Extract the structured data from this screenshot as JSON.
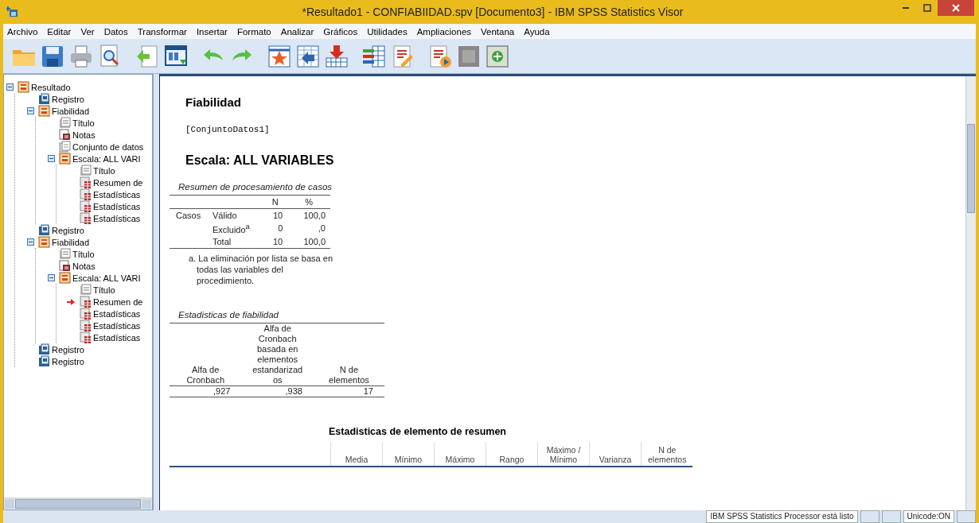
{
  "window": {
    "title": "*Resultado1 - CONFIABIIDAD.spv [Documento3] - IBM SPSS Statistics Visor"
  },
  "menu": [
    {
      "label": "Archivo"
    },
    {
      "label": "Editar"
    },
    {
      "label": "Ver"
    },
    {
      "label": "Datos"
    },
    {
      "label": "Transformar"
    },
    {
      "label": "Insertar"
    },
    {
      "label": "Formato"
    },
    {
      "label": "Analizar"
    },
    {
      "label": "Gráficos"
    },
    {
      "label": "Utilidades"
    },
    {
      "label": "Ampliaciones"
    },
    {
      "label": "Ventana"
    },
    {
      "label": "Ayuda"
    }
  ],
  "outline": {
    "items": [
      {
        "kind": "folder",
        "label": "Resultado",
        "expanded": true,
        "current": false,
        "children": [
          {
            "kind": "log",
            "label": "Registro",
            "current": false
          },
          {
            "kind": "folder",
            "label": "Fiabilidad",
            "expanded": true,
            "current": false,
            "children": [
              {
                "kind": "title",
                "label": "Título",
                "current": false
              },
              {
                "kind": "notes",
                "label": "Notas",
                "current": false
              },
              {
                "kind": "text",
                "label": "Conjunto de datos",
                "current": false
              },
              {
                "kind": "folder",
                "label": "Escala: ALL VARI",
                "expanded": true,
                "current": false,
                "children": [
                  {
                    "kind": "title",
                    "label": "Título",
                    "current": false
                  },
                  {
                    "kind": "table",
                    "label": "Resumen de",
                    "current": false
                  },
                  {
                    "kind": "table",
                    "label": "Estadísticas",
                    "current": false
                  },
                  {
                    "kind": "table",
                    "label": "Estadísticas",
                    "current": false
                  },
                  {
                    "kind": "table",
                    "label": "Estadísticas",
                    "current": false
                  }
                ]
              }
            ]
          },
          {
            "kind": "log",
            "label": "Registro",
            "current": false
          },
          {
            "kind": "folder",
            "label": "Fiabilidad",
            "expanded": true,
            "current": false,
            "children": [
              {
                "kind": "title",
                "label": "Título",
                "current": false
              },
              {
                "kind": "notes",
                "label": "Notas",
                "current": false
              },
              {
                "kind": "folder",
                "label": "Escala: ALL VARI",
                "expanded": true,
                "current": false,
                "children": [
                  {
                    "kind": "title",
                    "label": "Título",
                    "current": false
                  },
                  {
                    "kind": "table",
                    "label": "Resumen de",
                    "current": true
                  },
                  {
                    "kind": "table",
                    "label": "Estadísticas",
                    "current": false
                  },
                  {
                    "kind": "table",
                    "label": "Estadísticas",
                    "current": false
                  },
                  {
                    "kind": "table",
                    "label": "Estadísticas",
                    "current": false
                  }
                ]
              }
            ]
          },
          {
            "kind": "log",
            "label": "Registro",
            "current": false
          },
          {
            "kind": "log",
            "label": "Registro",
            "current": false
          }
        ]
      }
    ]
  },
  "output": {
    "heading": "Fiabilidad",
    "dataset": "[ConjuntoDatos1]",
    "subheading": "Escala: ALL VARIABLES",
    "case_summary": {
      "title": "Resumen de procesamiento de casos",
      "columns": [
        "N",
        "%"
      ],
      "rows": [
        {
          "group": "Casos",
          "label": "Válido",
          "values": [
            "10",
            "100,0"
          ]
        },
        {
          "label": "Excluido$^{a}$",
          "values": [
            "0",
            ",0"
          ]
        },
        {
          "label": "Total",
          "values": [
            "10",
            "100,0"
          ]
        }
      ],
      "footnote": "a. La eliminación por lista se basa en todas las variables del procedimiento."
    },
    "reliability": {
      "title": "Estadisticas de fiabilidad",
      "columns": [
        "Alfa de Cronbach",
        "Alfa de Cronbach basada en elementos estandarizados",
        "N de elementos"
      ],
      "rows": [
        [
          ",927",
          ",938",
          "17"
        ]
      ]
    },
    "summary_items": {
      "title": "Estadisticas de elemento de resumen",
      "columns": [
        "Media",
        "Mínimo",
        "Máximo",
        "Rango",
        "Máximo / Mínimo",
        "Varianza",
        "N de elementos"
      ]
    }
  },
  "status_bar": {
    "cells": [
      "IBM SPSS Statistics Processor está listo",
      "Unicode:ON"
    ]
  }
}
